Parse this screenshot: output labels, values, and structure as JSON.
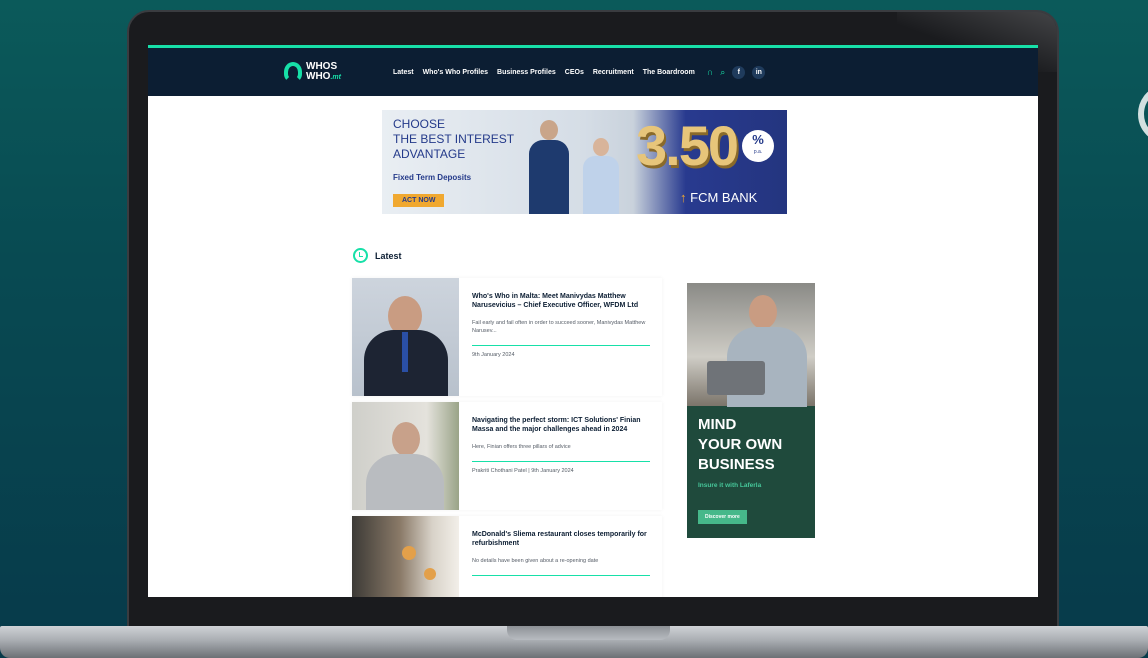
{
  "nav": {
    "logo_line1": "WHOS",
    "logo_line2": "WHO",
    "logo_tld": ".mt",
    "links": [
      "Latest",
      "Who's Who Profiles",
      "Business Profiles",
      "CEOs",
      "Recruitment",
      "The Boardroom"
    ],
    "social": [
      "f",
      "in"
    ]
  },
  "banner_ad": {
    "line1": "CHOOSE",
    "line2": "THE BEST INTEREST",
    "line3": "ADVANTAGE",
    "sub": "Fixed Term Deposits",
    "cta": "ACT NOW",
    "rate": "3.50",
    "pct": "%",
    "pct_sub": "p.a.",
    "bank": "FCM BANK"
  },
  "latest": {
    "title": "Latest",
    "articles": [
      {
        "title": "Who's Who in Malta: Meet Manivydas Matthew Narusevicius – Chief Executive Officer, WFDM Ltd",
        "excerpt": "Fail early and fail often in order to succeed sooner, Manivydas Matthew Narusev...",
        "meta": "9th January 2024"
      },
      {
        "title": "Navigating the perfect storm: ICT Solutions' Finian Massa and the major challenges ahead in 2024",
        "excerpt": "Here, Finian offers three pillars of advice",
        "meta": "Prakriti Chothani Patel | 9th January 2024"
      },
      {
        "title": "McDonald's Sliema restaurant closes temporarily for refurbishment",
        "excerpt": "No details have been given about a re-opening date",
        "meta": ""
      }
    ]
  },
  "side_ad": {
    "line1": "MIND",
    "line2": "YOUR OWN",
    "line3": "BUSINESS",
    "sub": "Insure it with Laferla",
    "cta": "Discover more"
  },
  "colors": {
    "accent": "#17e0a8",
    "navbar": "#0c1e33",
    "ad_blue": "#243a8a",
    "ad_green": "#1f4a3c"
  }
}
